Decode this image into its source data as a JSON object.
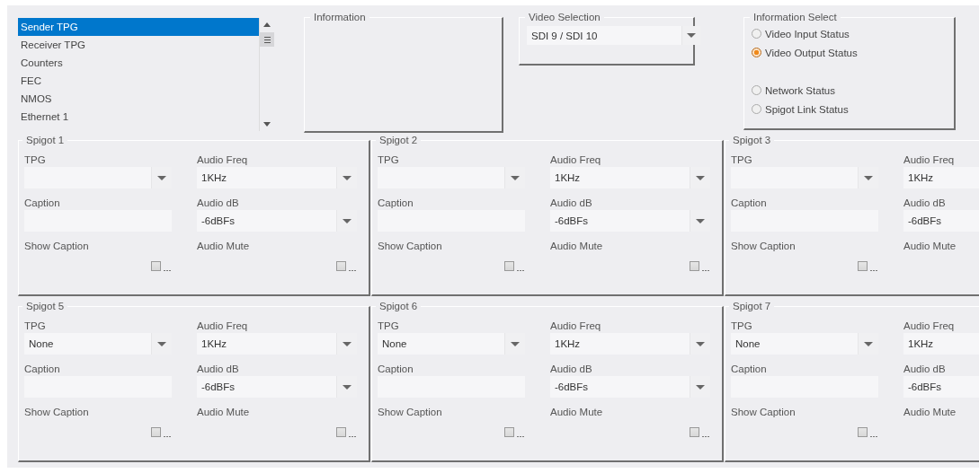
{
  "nav_list": {
    "items": [
      {
        "label": "Sender TPG",
        "selected": true
      },
      {
        "label": "Receiver TPG",
        "selected": false
      },
      {
        "label": "Counters",
        "selected": false
      },
      {
        "label": "FEC",
        "selected": false
      },
      {
        "label": "NMOS",
        "selected": false
      },
      {
        "label": "Ethernet 1",
        "selected": false
      }
    ]
  },
  "information": {
    "title": "Information"
  },
  "video_selection": {
    "title": "Video Selection",
    "value": "SDI 9 / SDI 10"
  },
  "information_select": {
    "title": "Information Select",
    "option_groups": [
      {
        "options": [
          {
            "label": "Video Input Status",
            "selected": false
          },
          {
            "label": "Video Output Status",
            "selected": true
          }
        ]
      },
      {
        "options": [
          {
            "label": "Network Status",
            "selected": false
          },
          {
            "label": "Spigot Link Status",
            "selected": false
          }
        ]
      }
    ]
  },
  "spigots": [
    {
      "title": "Spigot 1",
      "tpg_label": "TPG",
      "freq_label": "Audio Freq",
      "freq": "1KHz",
      "caption_label": "Caption",
      "db_label": "Audio dB",
      "db": "-6dBFs",
      "show_caption_label": "Show Caption",
      "show_caption_checked": false,
      "mute_label": "Audio Mute",
      "mute_checked": false
    },
    {
      "title": "Spigot 2",
      "tpg_label": "TPG",
      "freq_label": "Audio Freq",
      "freq": "1KHz",
      "caption_label": "Caption",
      "db_label": "Audio dB",
      "db": "-6dBFs",
      "show_caption_label": "Show Caption",
      "show_caption_checked": false,
      "mute_label": "Audio Mute",
      "mute_checked": false
    },
    {
      "title": "Spigot 3",
      "tpg_label": "TPG",
      "freq_label": "Audio Freq",
      "freq": "1KHz",
      "caption_label": "Caption",
      "db_label": "Audio dB",
      "db": "-6dBFs",
      "show_caption_label": "Show Caption",
      "show_caption_checked": false,
      "mute_label": "Audio Mute"
    },
    {
      "title": "Spigot 5",
      "tpg_label": "TPG",
      "tpg": "None",
      "freq_label": "Audio Freq",
      "freq": "1KHz",
      "caption_label": "Caption",
      "db_label": "Audio dB",
      "db": "-6dBFs",
      "show_caption_label": "Show Caption",
      "show_caption_checked": false,
      "mute_label": "Audio Mute",
      "mute_checked": false
    },
    {
      "title": "Spigot 6",
      "tpg_label": "TPG",
      "tpg": "None",
      "freq_label": "Audio Freq",
      "freq": "1KHz",
      "caption_label": "Caption",
      "db_label": "Audio dB",
      "db": "-6dBFs",
      "show_caption_label": "Show Caption",
      "show_caption_checked": false,
      "mute_label": "Audio Mute",
      "mute_checked": false
    },
    {
      "title": "Spigot 7",
      "tpg_label": "TPG",
      "tpg": "None",
      "freq_label": "Audio Freq",
      "freq": "1KHz",
      "caption_label": "Caption",
      "db_label": "Audio dB",
      "db": "-6dBFs",
      "show_caption_label": "Show Caption",
      "show_caption_checked": false,
      "mute_label": "Audio Mute"
    }
  ]
}
